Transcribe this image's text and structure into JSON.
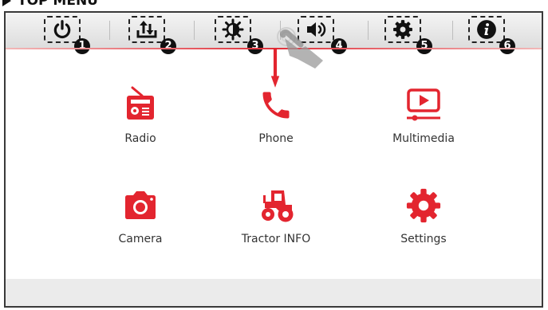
{
  "heading": {
    "title": "TOP MENU"
  },
  "toolbar": {
    "buttons": [
      {
        "icon": "power-icon",
        "badge": "1"
      },
      {
        "icon": "transfer-icon",
        "badge": "2"
      },
      {
        "icon": "brightness-icon",
        "badge": "3"
      },
      {
        "icon": "volume-icon",
        "badge": "4"
      },
      {
        "icon": "gear-icon",
        "badge": "5"
      },
      {
        "icon": "info-icon",
        "badge": "6"
      }
    ]
  },
  "apps": [
    {
      "label": "Radio",
      "icon": "radio-icon"
    },
    {
      "label": "Phone",
      "icon": "phone-icon"
    },
    {
      "label": "Multimedia",
      "icon": "multimedia-icon"
    },
    {
      "label": "Camera",
      "icon": "camera-icon"
    },
    {
      "label": "Tractor INFO",
      "icon": "tractor-icon"
    },
    {
      "label": "Settings",
      "icon": "settings-icon"
    }
  ],
  "colors": {
    "accent": "#e3252f",
    "icon_dark": "#111111"
  }
}
